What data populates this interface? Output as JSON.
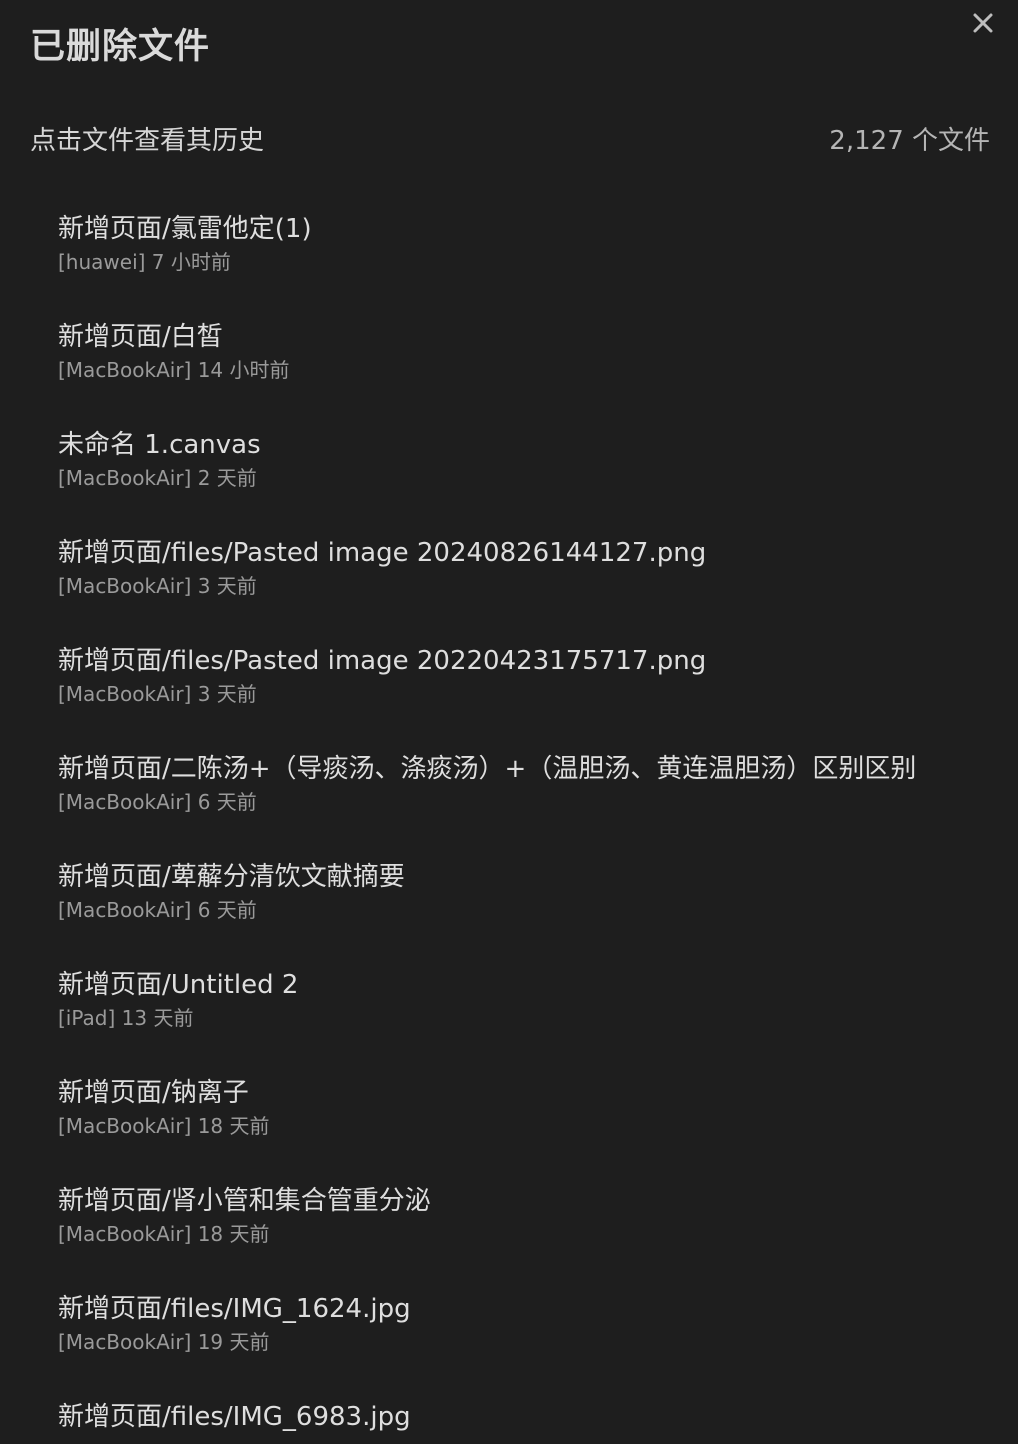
{
  "modal": {
    "title": "已删除文件",
    "subtitle": "点击文件查看其历史",
    "file_count": "2,127 个文件"
  },
  "icons": {
    "close": "close-icon"
  },
  "colors": {
    "background": "#1e1e1e",
    "primary_text": "#dedede",
    "secondary_text": "#9a9a9a"
  },
  "files": [
    {
      "name": "新增页面/氯雷他定(1)",
      "meta": "[huawei] 7 小时前"
    },
    {
      "name": "新增页面/白皙",
      "meta": "[MacBookAir] 14 小时前"
    },
    {
      "name": "未命名 1.canvas",
      "meta": "[MacBookAir] 2 天前"
    },
    {
      "name": "新增页面/files/Pasted image 20240826144127.png",
      "meta": "[MacBookAir] 3 天前"
    },
    {
      "name": "新增页面/files/Pasted image 20220423175717.png",
      "meta": "[MacBookAir] 3 天前"
    },
    {
      "name": "新增页面/二陈汤+（导痰汤、涤痰汤）+（温胆汤、黄连温胆汤）区别区别",
      "meta": "[MacBookAir] 6 天前"
    },
    {
      "name": "新增页面/萆薢分清饮文献摘要",
      "meta": "[MacBookAir] 6 天前"
    },
    {
      "name": "新增页面/Untitled 2",
      "meta": "[iPad] 13 天前"
    },
    {
      "name": "新增页面/钠离子",
      "meta": "[MacBookAir] 18 天前"
    },
    {
      "name": "新增页面/肾小管和集合管重分泌",
      "meta": "[MacBookAir] 18 天前"
    },
    {
      "name": "新增页面/files/IMG_1624.jpg",
      "meta": "[MacBookAir] 19 天前"
    },
    {
      "name": "新增页面/files/IMG_6983.jpg",
      "meta": ""
    }
  ]
}
